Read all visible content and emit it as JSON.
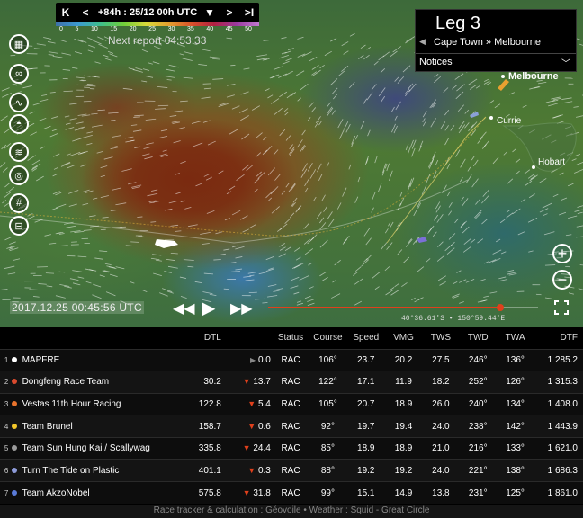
{
  "timebar": {
    "first": "K",
    "prev": "<",
    "label": "+84h : 25/12 00h UTC",
    "dropdown": "▼",
    "next": ">",
    "last": ">I",
    "scale_ticks": [
      "0",
      "5",
      "10",
      "15",
      "20",
      "25",
      "30",
      "35",
      "40",
      "45",
      "50"
    ]
  },
  "next_report": "Next report 04:53:33",
  "leg": {
    "title": "Leg 3",
    "route": "Cape Town » Melbourne",
    "notices": "Notices"
  },
  "places": {
    "melbourne": "Melbourne",
    "currie": "Currie",
    "hobart": "Hobart"
  },
  "playback": {
    "datetime": "2017.12.25 00:45:56 UTC",
    "progress": 0.86,
    "coords": "40°36.61'S • 150°59.44'E"
  },
  "table": {
    "headers": {
      "dtl": "DTL",
      "status": "Status",
      "course": "Course",
      "speed": "Speed",
      "vmg": "VMG",
      "tws": "TWS",
      "twd": "TWD",
      "twa": "TWA",
      "dtf": "DTF"
    },
    "rows": [
      {
        "rank": "1",
        "color": "#ffffff",
        "name": "MAPFRE",
        "dtl": "",
        "dtl_delta": "0.0",
        "trend": "right",
        "status": "RAC",
        "course": "106°",
        "speed": "23.7",
        "vmg": "20.2",
        "tws": "27.5",
        "twd": "246°",
        "twa": "136°",
        "dtf": "1 285.2"
      },
      {
        "rank": "2",
        "color": "#d94a2e",
        "name": "Dongfeng Race Team",
        "dtl": "30.2",
        "dtl_delta": "13.7",
        "trend": "down",
        "status": "RAC",
        "course": "122°",
        "speed": "17.1",
        "vmg": "11.9",
        "tws": "18.2",
        "twd": "252°",
        "twa": "126°",
        "dtf": "1 315.3"
      },
      {
        "rank": "3",
        "color": "#e8732c",
        "name": "Vestas 11th Hour Racing",
        "dtl": "122.8",
        "dtl_delta": "5.4",
        "trend": "down",
        "status": "RAC",
        "course": "105°",
        "speed": "20.7",
        "vmg": "18.9",
        "tws": "26.0",
        "twd": "240°",
        "twa": "134°",
        "dtf": "1 408.0"
      },
      {
        "rank": "4",
        "color": "#f2c62a",
        "name": "Team Brunel",
        "dtl": "158.7",
        "dtl_delta": "0.6",
        "trend": "down",
        "status": "RAC",
        "course": "92°",
        "speed": "19.7",
        "vmg": "19.4",
        "tws": "24.0",
        "twd": "238°",
        "twa": "142°",
        "dtf": "1 443.9"
      },
      {
        "rank": "5",
        "color": "#9a9a9a",
        "name": "Team Sun Hung Kai / Scallywag",
        "dtl": "335.8",
        "dtl_delta": "24.4",
        "trend": "down",
        "status": "RAC",
        "course": "85°",
        "speed": "18.9",
        "vmg": "18.9",
        "tws": "21.0",
        "twd": "216°",
        "twa": "133°",
        "dtf": "1 621.0"
      },
      {
        "rank": "6",
        "color": "#8d9ad8",
        "name": "Turn The Tide on Plastic",
        "dtl": "401.1",
        "dtl_delta": "0.3",
        "trend": "down",
        "status": "RAC",
        "course": "88°",
        "speed": "19.2",
        "vmg": "19.2",
        "tws": "24.0",
        "twd": "221°",
        "twa": "138°",
        "dtf": "1 686.3"
      },
      {
        "rank": "7",
        "color": "#5a7bd8",
        "name": "Team AkzoNobel",
        "dtl": "575.8",
        "dtl_delta": "31.8",
        "trend": "down",
        "status": "RAC",
        "course": "99°",
        "speed": "15.1",
        "vmg": "14.9",
        "tws": "13.8",
        "twd": "231°",
        "twa": "125°",
        "dtf": "1 861.0"
      }
    ]
  },
  "footer": "Race tracker & calculation : Géovoile • Weather : Squid - Great Circle"
}
